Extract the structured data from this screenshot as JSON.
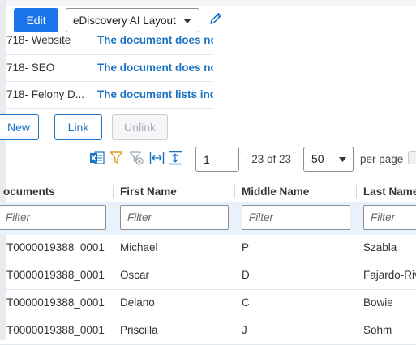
{
  "toolbar": {
    "edit_label": "Edit",
    "layout_value": "eDiscovery AI Layout"
  },
  "related": [
    {
      "id": "718- Website",
      "description": "The document does no"
    },
    {
      "id": "718- SEO",
      "description": "The document does no"
    },
    {
      "id": "718- Felony D...",
      "description": "The document lists ind"
    }
  ],
  "actions": {
    "new_label": "New",
    "link_label": "Link",
    "unlink_label": "Unlink"
  },
  "pager": {
    "page": "1",
    "range": "- 23 of 23",
    "page_size": "50",
    "per_page_label": "per page"
  },
  "grid": {
    "columns": [
      "ocuments",
      "First Name",
      "Middle Name",
      "Last Name"
    ],
    "filter_placeholder": "Filter",
    "rows": [
      [
        "T0000019388_0001",
        "Michael",
        "P",
        "Szabla"
      ],
      [
        "T0000019388_0001",
        "Oscar",
        "D",
        "Fajardo-Riv"
      ],
      [
        "T0000019388_0001",
        "Delano",
        "C",
        "Bowie"
      ],
      [
        "T0000019388_0001",
        "Priscilla",
        "J",
        "Sohm"
      ]
    ]
  },
  "colors": {
    "primary": "#1a73e8",
    "link": "#1a73c4",
    "filter_row_bg": "#e9f1fa"
  }
}
